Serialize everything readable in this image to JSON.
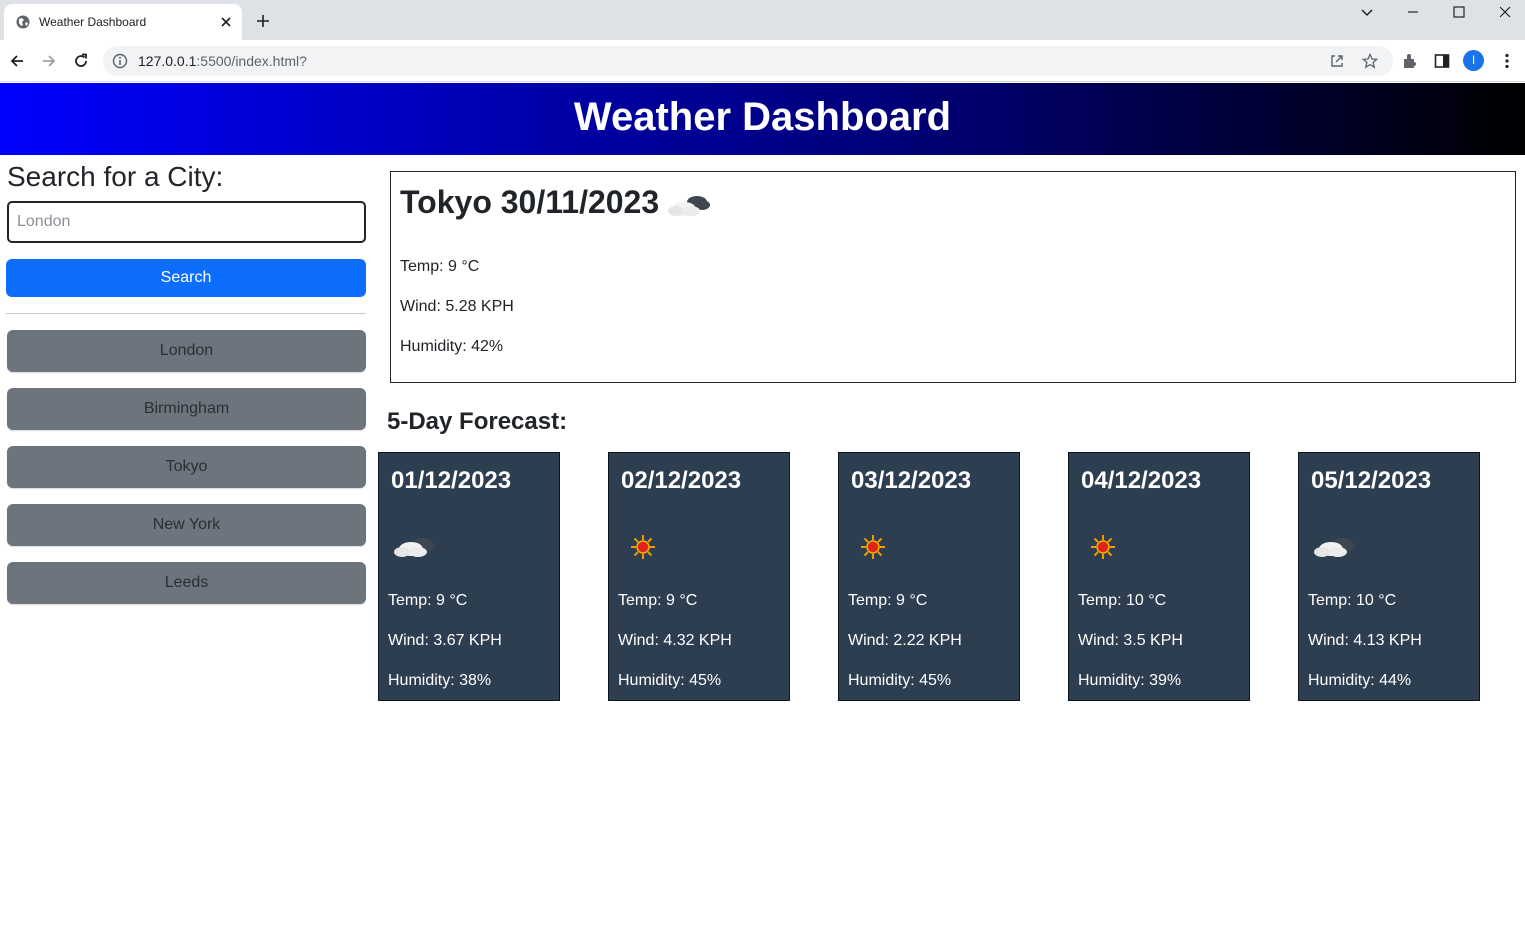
{
  "browser": {
    "tab_title": "Weather Dashboard",
    "url_host": "127.0.0.1",
    "url_rest": ":5500/index.html?",
    "profile_initial": "I"
  },
  "header": {
    "title": "Weather Dashboard"
  },
  "search": {
    "title": "Search for a City:",
    "placeholder": "London",
    "button_label": "Search"
  },
  "history": [
    "London",
    "Birmingham",
    "Tokyo",
    "New York",
    "Leeds"
  ],
  "current": {
    "title": "Tokyo 30/11/2023",
    "icon": "cloudy-icon",
    "temp": "Temp: 9 °C",
    "wind": "Wind: 5.28 KPH",
    "humidity": "Humidity: 42%"
  },
  "forecast": {
    "title": "5-Day Forecast:",
    "days": [
      {
        "date": "01/12/2023",
        "icon": "cloudy-icon",
        "temp": "Temp: 9 °C",
        "wind": "Wind: 3.67 KPH",
        "humidity": "Humidity: 38%"
      },
      {
        "date": "02/12/2023",
        "icon": "sun-icon",
        "temp": "Temp: 9 °C",
        "wind": "Wind: 4.32 KPH",
        "humidity": "Humidity: 45%"
      },
      {
        "date": "03/12/2023",
        "icon": "sun-icon",
        "temp": "Temp: 9 °C",
        "wind": "Wind: 2.22 KPH",
        "humidity": "Humidity: 45%"
      },
      {
        "date": "04/12/2023",
        "icon": "sun-icon",
        "temp": "Temp: 10 °C",
        "wind": "Wind: 3.5 KPH",
        "humidity": "Humidity: 39%"
      },
      {
        "date": "05/12/2023",
        "icon": "cloudy-icon",
        "temp": "Temp: 10 °C",
        "wind": "Wind: 4.13 KPH",
        "humidity": "Humidity: 44%"
      }
    ]
  },
  "colors": {
    "header_start": "#0000ff",
    "header_end": "#000000",
    "search_button": "#0d6efd",
    "history_button": "#6c757d",
    "forecast_card": "#2d3e50"
  }
}
